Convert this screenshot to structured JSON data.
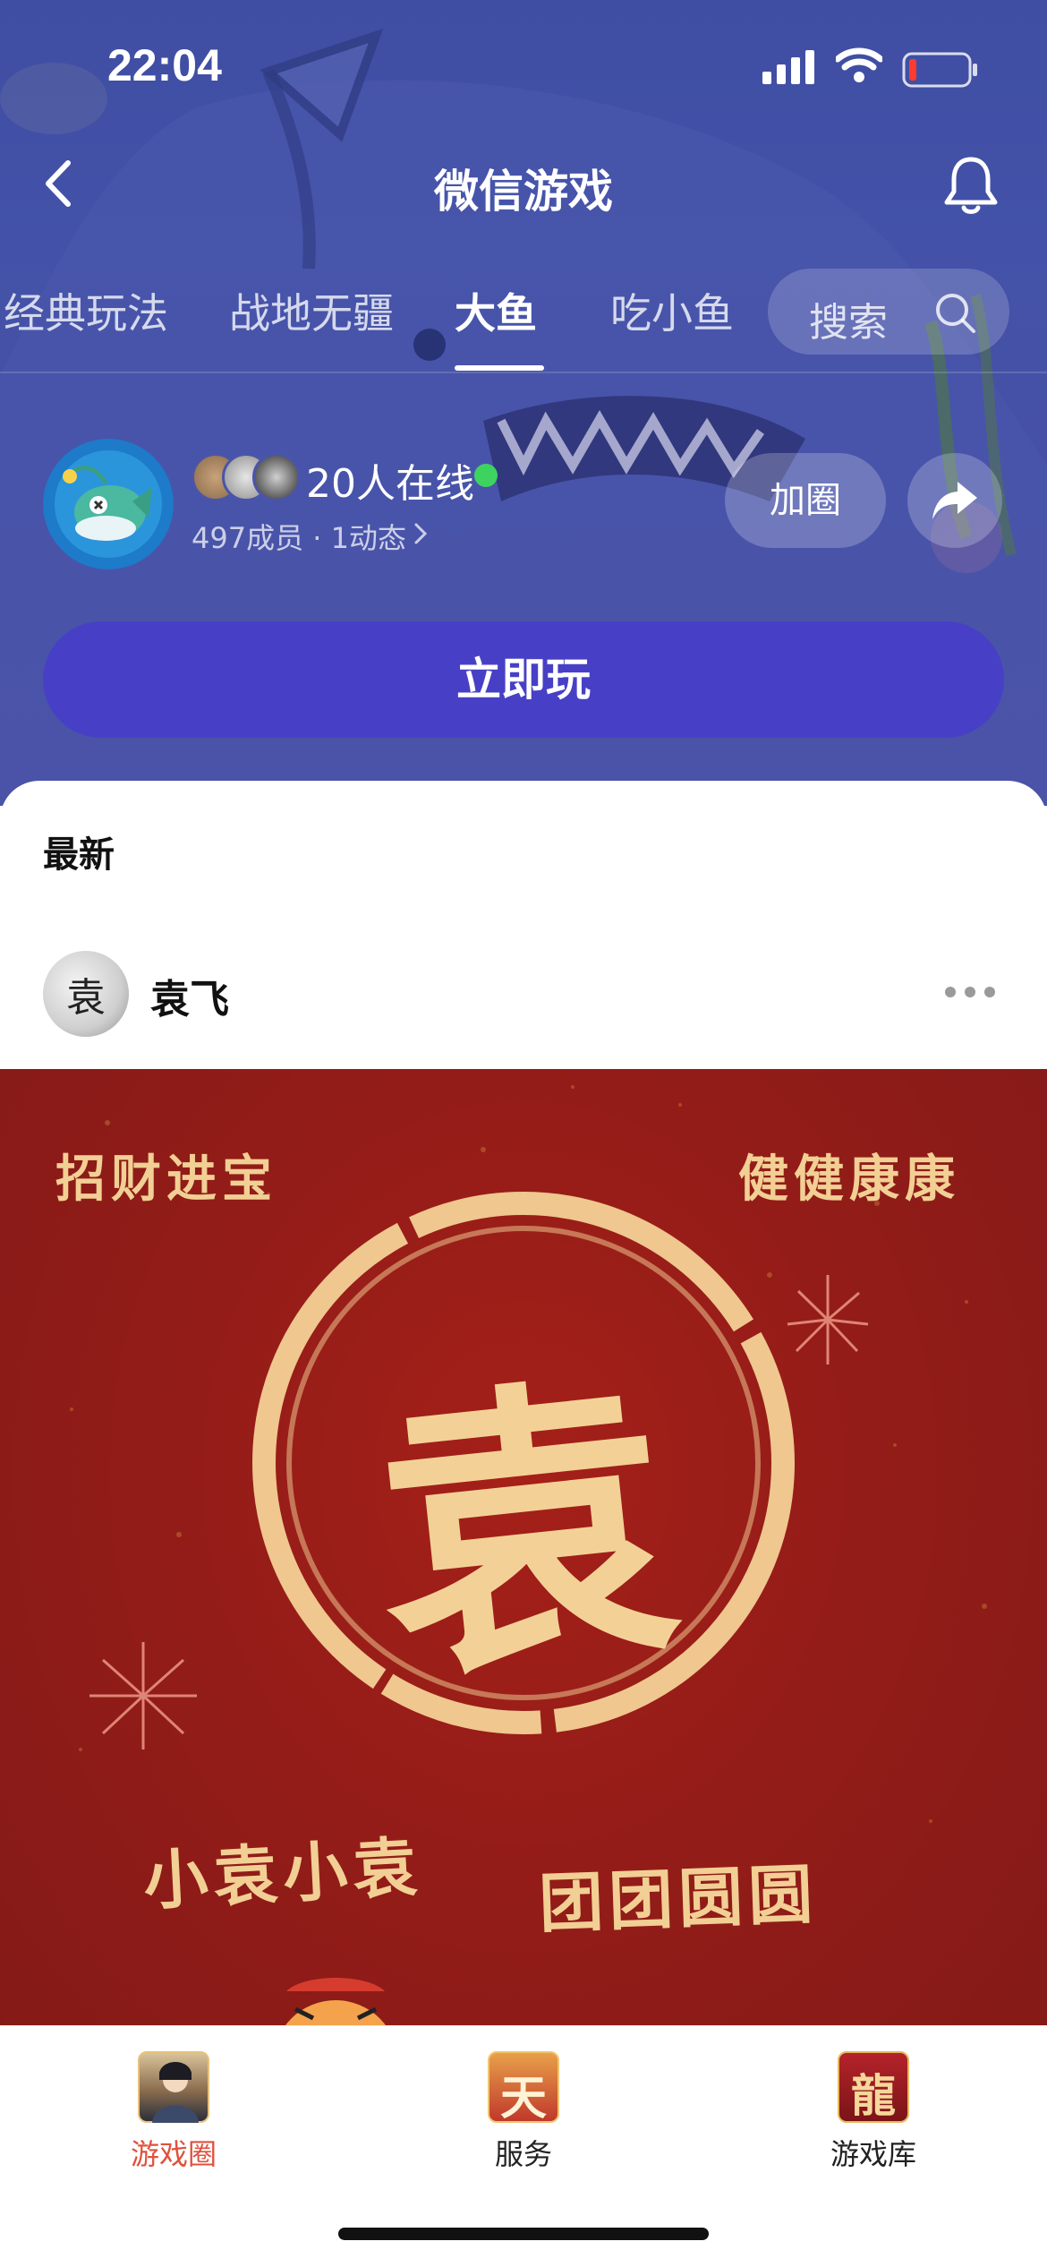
{
  "status_bar": {
    "time": "22:04"
  },
  "nav": {
    "title": "微信游戏"
  },
  "tabs": [
    {
      "label": "经典玩法",
      "active": false
    },
    {
      "label": "战地无疆",
      "active": false
    },
    {
      "label": "大鱼",
      "active": true
    },
    {
      "label": "吃小鱼",
      "active": false
    }
  ],
  "search": {
    "label": "搜索"
  },
  "circle": {
    "online": "20人在线",
    "members": "497成员",
    "posts": "1动态",
    "join_label": "加圈"
  },
  "play_button": "立即玩",
  "feed": {
    "section_title": "最新",
    "post": {
      "author": "袁飞",
      "avatar_char": "袁",
      "image": {
        "top_left": "招财进宝",
        "top_right": "健健康康",
        "center_char": "袁",
        "bottom_left": "小袁小袁",
        "bottom_right": "团团圆圆"
      }
    }
  },
  "tabbar": {
    "items": [
      {
        "label": "游戏圈",
        "active": true
      },
      {
        "label": "服务",
        "active": false,
        "icon_char": "天"
      },
      {
        "label": "游戏库",
        "active": false,
        "icon_char": "龍"
      }
    ]
  },
  "colors": {
    "hero_blue": "#4352a8",
    "play_button": "#4740c6",
    "online_green": "#3ed35f",
    "poster_red": "#941c18",
    "poster_gold": "#f2cf94",
    "active_tab": "#e0513d"
  }
}
